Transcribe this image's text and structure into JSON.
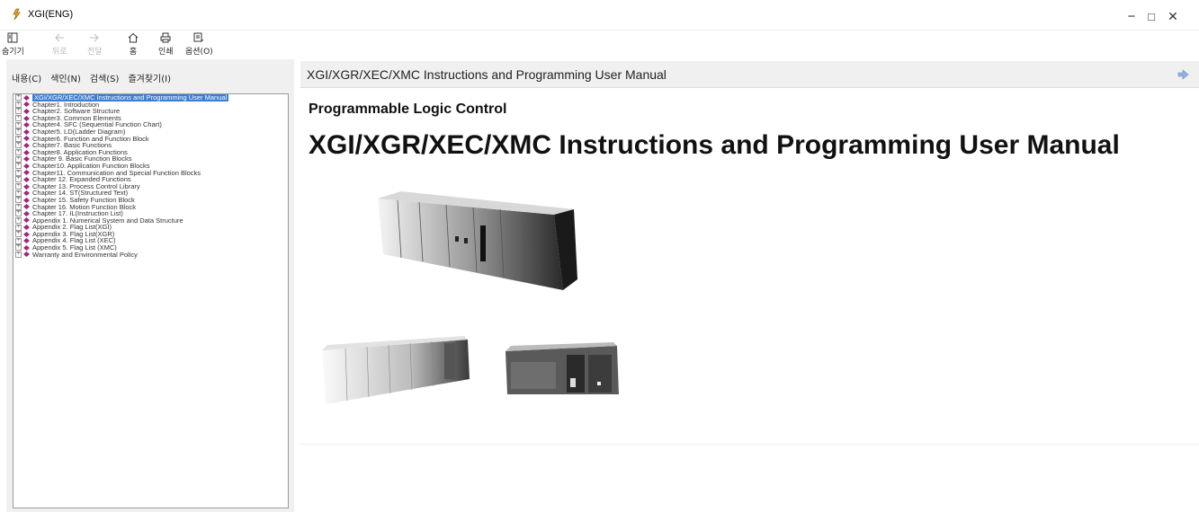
{
  "window": {
    "title": "XGI(ENG)",
    "minimize_label": "−",
    "maximize_label": "□",
    "close_label": "✕"
  },
  "toolbar": {
    "hide_label": "숨기기",
    "back_label": "뒤로",
    "forward_label": "전달",
    "home_label": "홈",
    "print_label": "인쇄",
    "options_label": "옵션(O)"
  },
  "tabs": {
    "contents": "내용(C)",
    "index": "색인(N)",
    "search": "검색(S)",
    "favorites": "즐겨찾기(I)"
  },
  "tree": {
    "items": [
      "XGI/XGR/XEC/XMC Instructions and Programming User Manual",
      "Chapter1. Introduction",
      "Chapter2. Software Structure",
      "Chapter3. Common Elements",
      "Chapter4. SFC (Sequential Function Chart)",
      "Chapter5. LD(Ladder Diagram)",
      "Chapter6. Function and Function Block",
      "Chapter7. Basic Functions",
      "Chapter8. Application Functions",
      "Chapter 9. Basic Function Blocks",
      "Chapter10. Application Function Blocks",
      "Chapter11. Communication and Special Function Blocks",
      "Chapter 12. Expanded Functions",
      "Chapter 13. Process Control Library",
      "Chapter 14. ST(Structured Text)",
      "Chapter 15. Safety Function Block",
      "Chapter 16. Motion Function Block",
      "Chapter 17. IL(Instruction List)",
      "Appendix 1. Numerical System and Data Structure",
      "Appendix 2. Flag List(XGI)",
      "Appendix 3. Flag List(XGR)",
      "Appendix 4. Flag List (XEC)",
      "Appendix 5. Flag List (XMC)",
      "Warranty and Environmental Policy"
    ],
    "expander_symbol": "+"
  },
  "content": {
    "header_title": "XGI/XGR/XEC/XMC Instructions and Programming User Manual",
    "subtitle": "Programmable Logic Control",
    "title": "XGI/XGR/XEC/XMC Instructions and Programming User Manual"
  },
  "icons": {
    "app": "xgi-app-icon",
    "hide": "hide-pane-icon",
    "back": "back-arrow-icon",
    "forward": "forward-arrow-icon",
    "home": "home-icon",
    "print": "print-icon",
    "options": "options-icon",
    "next_topic": "next-topic-arrow-icon",
    "book": "book-icon"
  },
  "colors": {
    "selection": "#3a7fd5",
    "book_icon": "#a0287a",
    "arrow": "#8fb1e0"
  }
}
